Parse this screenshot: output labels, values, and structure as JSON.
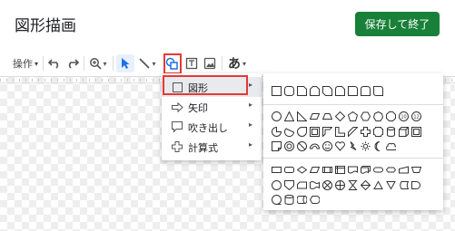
{
  "header": {
    "title": "図形描画",
    "save_label": "保存して終了"
  },
  "toolbar": {
    "actions_label": "操作",
    "dropdown_glyph": "▾",
    "undo_icon": "undo-icon",
    "redo_icon": "redo-icon",
    "zoom_icon": "zoom-icon",
    "select_icon": "select-cursor-icon",
    "line_icon": "line-icon",
    "shape_icon": "shape-icon",
    "textbox_icon": "textbox-icon",
    "image_icon": "image-icon",
    "wordart_label": "あ"
  },
  "shape_menu": {
    "items": [
      {
        "label": "図形",
        "icon": "square-icon",
        "arrow": "▸"
      },
      {
        "label": "矢印",
        "icon": "arrow-icon",
        "arrow": "▸"
      },
      {
        "label": "吹き出し",
        "icon": "callout-icon",
        "arrow": "▸"
      },
      {
        "label": "計算式",
        "icon": "equation-icon",
        "arrow": "▸"
      }
    ],
    "active_index": 0
  },
  "colors": {
    "accent": "#188038",
    "highlight": "#e53935",
    "menu_active": "#e8eaed"
  }
}
